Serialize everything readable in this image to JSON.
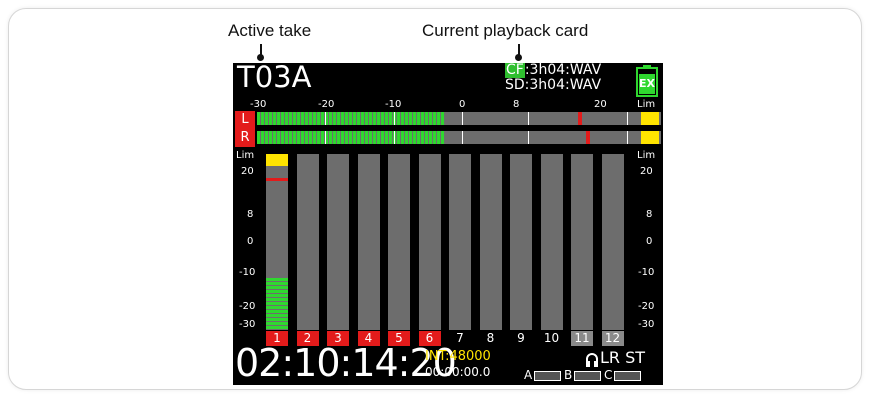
{
  "callouts": {
    "active_take": "Active take",
    "playback_card": "Current playback card"
  },
  "screen": {
    "take_name": "T03A",
    "cards": {
      "cf_label": "CF",
      "cf_value": ":3h04:WAV",
      "sd_value": "SD:3h04:WAV"
    },
    "battery_label": "EX",
    "meter_scale": [
      "-30",
      "-20",
      "-10",
      "0",
      "8",
      "20",
      "Lim"
    ],
    "lr_labels": [
      "L",
      "R"
    ],
    "l_level_db": -3,
    "r_level_db": -3,
    "l_peak_db": 14,
    "r_peak_db": 15,
    "vertical_scale": [
      "Lim",
      "20",
      "8",
      "0",
      "-10",
      "-20",
      "-30"
    ],
    "channels": [
      {
        "label": "1",
        "state": "armed"
      },
      {
        "label": "2",
        "state": "armed"
      },
      {
        "label": "3",
        "state": "armed"
      },
      {
        "label": "4",
        "state": "armed"
      },
      {
        "label": "5",
        "state": "armed"
      },
      {
        "label": "6",
        "state": "armed"
      },
      {
        "label": "7",
        "state": "off"
      },
      {
        "label": "8",
        "state": "off"
      },
      {
        "label": "9",
        "state": "off"
      },
      {
        "label": "10",
        "state": "off"
      },
      {
        "label": "11",
        "state": "grey"
      },
      {
        "label": "12",
        "state": "grey"
      }
    ],
    "ch1_level_db": -11,
    "ch1_peak_db": 18,
    "timecode": "02:10:14:20",
    "sample_rate": "INT:48000",
    "elapsed": "00:00:00.0",
    "monitor": "LR ST",
    "slots": [
      "A",
      "B",
      "C"
    ],
    "colors": {
      "meter_green": "#2fd82f",
      "armed_red": "#e31b1b",
      "lim_yellow": "#ffe400",
      "int_yellow": "#ffe400"
    }
  }
}
